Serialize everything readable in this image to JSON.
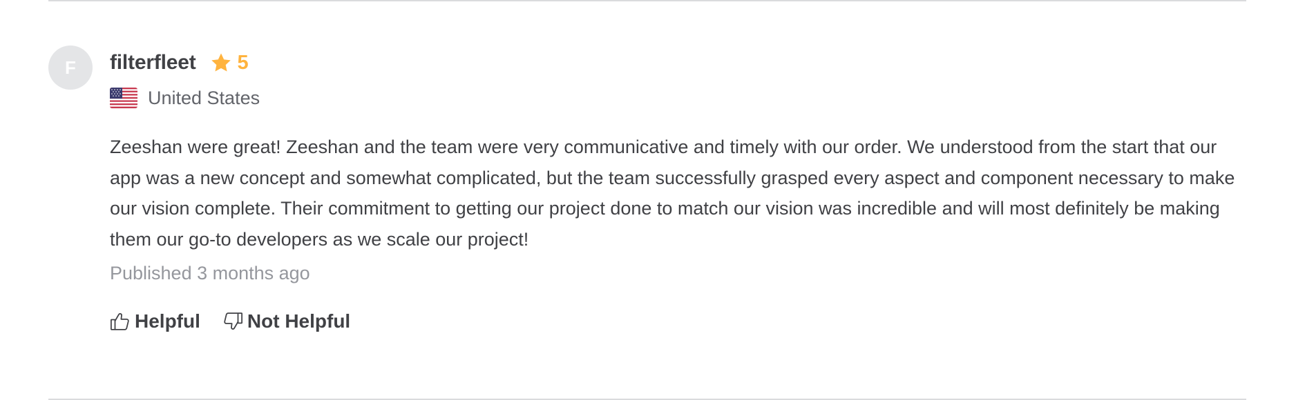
{
  "review": {
    "avatar_initial": "F",
    "username": "filterfleet",
    "rating": "5",
    "country": "United States",
    "text": "Zeeshan were great! Zeeshan and the team were very communicative and timely with our order. We understood from the start that our app was a new concept and somewhat complicated, but the team successfully grasped every aspect and component necessary to make our vision complete. Their commitment to getting our project done to match our vision was incredible and will most definitely be making them our go-to developers as we scale our project!",
    "published": "Published 3 months ago"
  },
  "feedback": {
    "helpful_label": "Helpful",
    "not_helpful_label": "Not Helpful"
  },
  "icons": {
    "rating": "star-icon",
    "country": "us-flag-icon",
    "helpful": "thumbs-up-icon",
    "not_helpful": "thumbs-down-icon"
  },
  "colors": {
    "star": "#ffb33e",
    "avatar_bg": "#e4e5e7",
    "text": "#404145",
    "muted": "#95979d",
    "divider": "#dadbdd"
  }
}
